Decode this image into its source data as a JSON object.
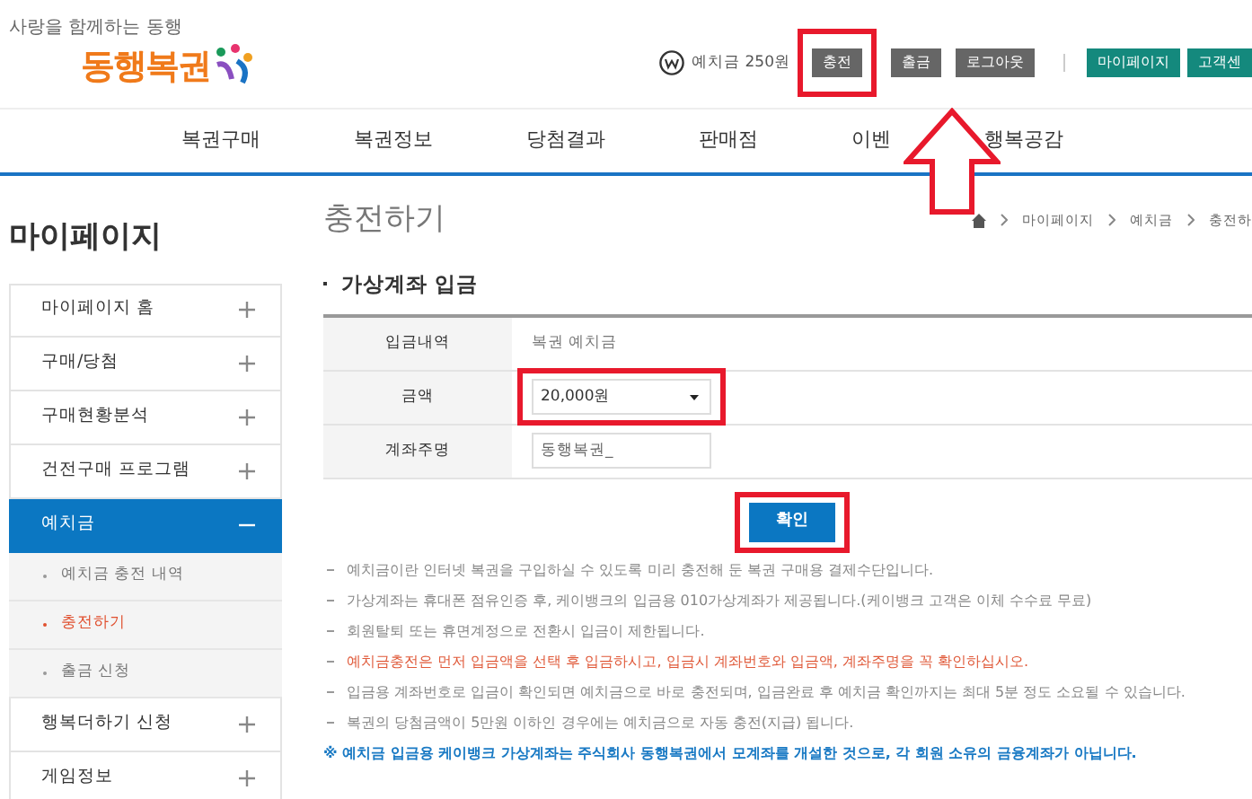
{
  "header": {
    "tagline": "사랑을 함께하는 동행",
    "logo": "동행복권",
    "balance_label": "예치금 250원",
    "account_buttons": [
      {
        "label": "충전",
        "highlighted": true
      },
      {
        "label": "출금",
        "highlighted": false
      },
      {
        "label": "로그아웃",
        "highlighted": false
      }
    ],
    "site_buttons": [
      "마이페이지",
      "고객센"
    ],
    "pointer_arrow": true
  },
  "nav": [
    "복권구매",
    "복권정보",
    "당첨결과",
    "판매점",
    "이벤",
    "행복공감"
  ],
  "sidebar": {
    "title": "마이페이지",
    "items": [
      {
        "label": "마이페이지 홈",
        "expanded": false,
        "selected": false
      },
      {
        "label": "구매/당첨",
        "expanded": false,
        "selected": false
      },
      {
        "label": "구매현황분석",
        "expanded": false,
        "selected": false
      },
      {
        "label": "건전구매 프로그램",
        "expanded": false,
        "selected": false
      },
      {
        "label": "예치금",
        "expanded": true,
        "selected": true,
        "children": [
          {
            "label": "예치금 충전 내역",
            "selected": false
          },
          {
            "label": "충전하기",
            "selected": true
          },
          {
            "label": "출금 신청",
            "selected": false
          }
        ]
      },
      {
        "label": "행복더하기 신청",
        "expanded": false,
        "selected": false
      },
      {
        "label": "게임정보",
        "expanded": false,
        "selected": false
      }
    ]
  },
  "page": {
    "title": "충전하기",
    "breadcrumb": [
      "마이페이지",
      "예치금",
      "충전하"
    ],
    "section_title": "가상계좌 입금",
    "form": [
      {
        "kind": "text",
        "label": "입금내역",
        "value": "복권 예치금",
        "highlighted": false
      },
      {
        "kind": "select",
        "label": "금액",
        "value": "20,000원",
        "highlighted": true
      },
      {
        "kind": "input",
        "label": "계좌주명",
        "value": "동행복권_",
        "highlighted": false
      }
    ],
    "confirm": {
      "label": "확인",
      "highlighted": true
    },
    "notes": [
      {
        "kind": "plain",
        "text": "예치금이란 인터넷 복권을 구입하실 수 있도록 미리 충전해 둔 복권 구매용 결제수단입니다."
      },
      {
        "kind": "plain",
        "text": "가상계좌는 휴대폰 점유인증 후, 케이뱅크의 입금용 010가상계좌가 제공됩니다.(케이뱅크 고객은 이체 수수료 무료)"
      },
      {
        "kind": "plain",
        "text": "회원탈퇴 또는 휴면계정으로 전환시 입금이 제한됩니다."
      },
      {
        "kind": "warning",
        "text": "예치금충전은 먼저 입금액을 선택 후 입금하시고, 입금시 계좌번호와 입금액, 계좌주명을 꼭 확인하십시오."
      },
      {
        "kind": "plain",
        "text": "입금용 계좌번호로 입금이 확인되면 예치금으로 바로 충전되며, 입금완료 후 예치금 확인까지는 최대 5분 정도 소요될 수 있습니다."
      },
      {
        "kind": "plain",
        "text": "복권의 당첨금액이 5만원 이하인 경우에는 예치금으로 자동 충전(지급) 됩니다."
      },
      {
        "kind": "info",
        "text": "※ 예치금 입금용 케이뱅크 가상계좌는 주식회사 동행복권에서 모계좌를 개설한 것으로, 각 회원 소유의 금융계좌가 아닙니다."
      }
    ]
  }
}
